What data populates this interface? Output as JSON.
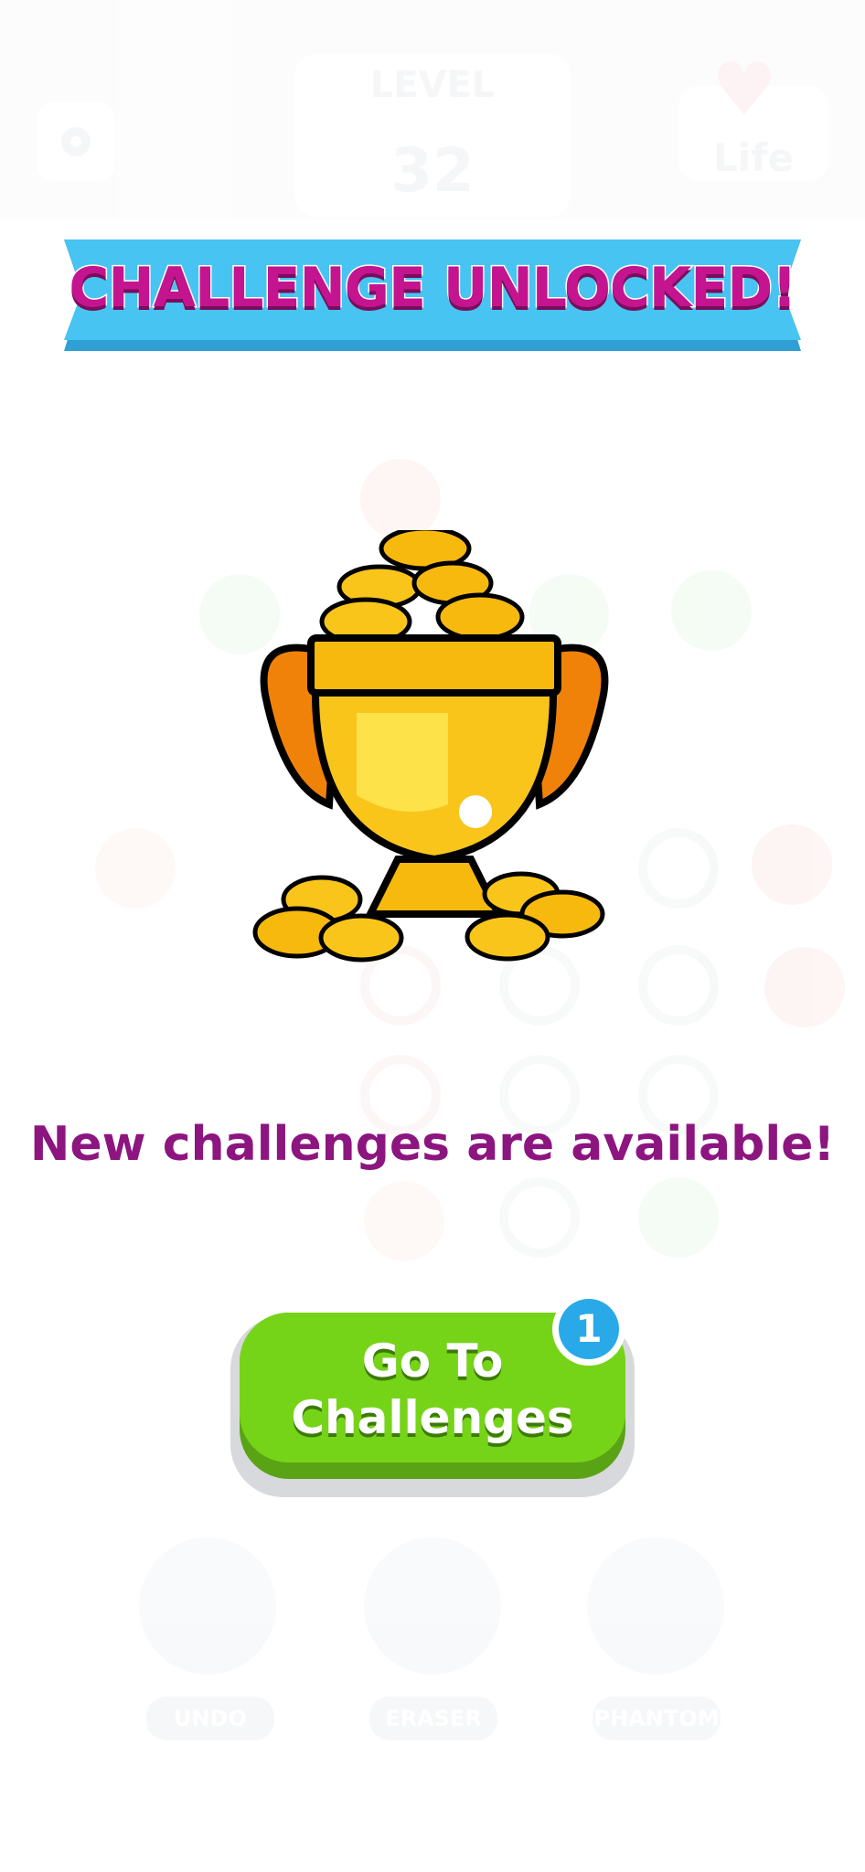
{
  "header": {
    "level_label": "LEVEL",
    "level_number": "32",
    "life_label": "Life"
  },
  "powerups": [
    {
      "label": "UNDO"
    },
    {
      "label": "ERASER"
    },
    {
      "label": "PHANTOM"
    }
  ],
  "modal": {
    "banner_title": "CHALLENGE UNLOCKED!",
    "message": "New challenges are available!",
    "cta_label": "Go To\nChallenges",
    "badge_count": "1"
  },
  "colors": {
    "banner_bg": "#47c4f2",
    "title_text": "#c4148f",
    "message_text": "#8c1580",
    "button_green": "#76d418",
    "badge_blue": "#2aa9e8"
  }
}
